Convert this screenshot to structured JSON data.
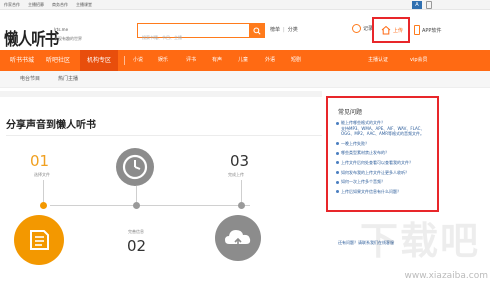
{
  "topbar": {
    "links": [
      "作家合作",
      "主播招募",
      "商务合作",
      "主播课堂"
    ],
    "badge": "A"
  },
  "header": {
    "logo": "懒人听书",
    "logo_sub": "lrts.me",
    "logo_tag": "发现有趣的世界",
    "search_placeholder": "搜索书籍、节目、主播",
    "search_links": [
      "榜单",
      "|",
      "分类"
    ],
    "history_label": "记录",
    "upload_label": "上传",
    "app_label": "APP软件"
  },
  "nav": {
    "items": [
      "听书书城",
      "听吧社区",
      "机构专区"
    ],
    "active_index": 2,
    "categories": [
      "小说",
      "娱乐",
      "评书",
      "有声",
      "儿童",
      "外语",
      "短剧"
    ],
    "right_items": [
      "主播认证",
      "vip会员"
    ]
  },
  "subnav": {
    "items": [
      "电台节目",
      "热门主播"
    ]
  },
  "main": {
    "title": "分享声音到懒人听书",
    "steps": [
      {
        "num": "01",
        "caption": "选择文件"
      },
      {
        "num": "02",
        "caption": "完善信息"
      },
      {
        "num": "03",
        "caption": "完成上传"
      }
    ]
  },
  "faq": {
    "title": "常见问题",
    "items": [
      {
        "lines": [
          "能上传哪些格式的文件？",
          "支持MP3、WMA、APE、AIF、WAV、FLAC、",
          "OGG、MP2、AAC、AMR等格式的音频文件。"
        ]
      },
      {
        "lines": [
          "一晚上传失败？"
        ],
        "gap": true
      },
      {
        "lines": [
          "哪些类型素材禁止发布的？"
        ]
      },
      {
        "lines": [
          "上传文件后何处查看可以查看我的文件？"
        ]
      },
      {
        "lines": [
          "如何发布我的上传文件让更多人收听？"
        ]
      },
      {
        "lines": [
          "如何一次上传多个音频？"
        ]
      },
      {
        "lines": [
          "上传后如果文件信息有什么问题？"
        ]
      }
    ]
  },
  "more_text": "还有问题？请联系我们在线客服",
  "watermark": "下载吧",
  "watermark_url": "www.xiazaiba.com",
  "colors": {
    "brand_orange": "#ff6a13",
    "highlight_red": "#e8262a",
    "step_orange": "#f39800",
    "link_blue": "#2b5c9a"
  }
}
